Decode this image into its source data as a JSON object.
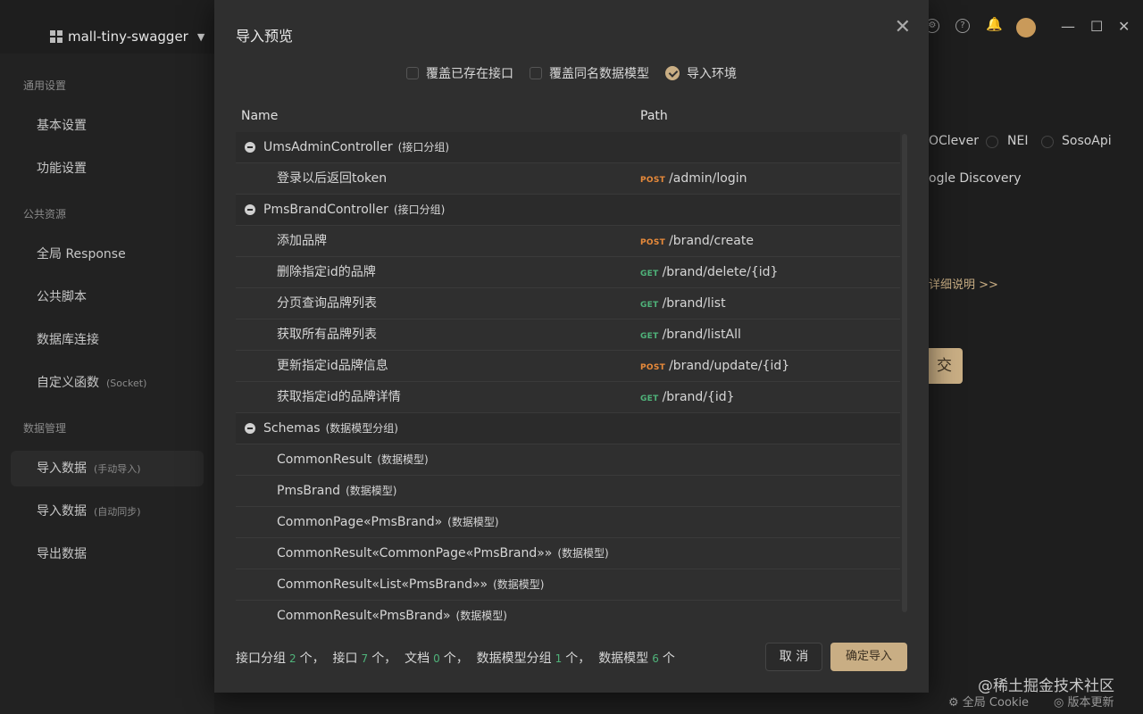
{
  "app": {
    "project_name": "mall-tiny-swagger"
  },
  "sidebar": {
    "sections": [
      {
        "title": "通用设置"
      },
      {
        "title": "公共资源"
      },
      {
        "title": "数据管理"
      }
    ],
    "items": [
      {
        "label": "基本设置",
        "sub": ""
      },
      {
        "label": "功能设置",
        "sub": ""
      },
      {
        "label": "全局 Response",
        "sub": ""
      },
      {
        "label": "公共脚本",
        "sub": ""
      },
      {
        "label": "数据库连接",
        "sub": ""
      },
      {
        "label": "自定义函数",
        "sub": "(Socket)"
      },
      {
        "label": "导入数据",
        "sub": "(手动导入)"
      },
      {
        "label": "导入数据",
        "sub": "(自动同步)"
      },
      {
        "label": "导出数据",
        "sub": ""
      }
    ]
  },
  "background": {
    "option_a": "OClever",
    "option_b": "NEI",
    "option_c": "SosoApi",
    "option_d": "ogle Discovery",
    "detail_link": "详细说明 >>",
    "submit_partial": "交",
    "footer_cookie": "全局 Cookie",
    "footer_update": "版本更新",
    "watermark": "@稀土掘金技术社区"
  },
  "modal": {
    "title": "导入预览",
    "options": [
      {
        "label": "覆盖已存在接口",
        "checked": false
      },
      {
        "label": "覆盖同名数据模型",
        "checked": false
      },
      {
        "label": "导入环境",
        "checked": true
      }
    ],
    "columns": {
      "name": "Name",
      "path": "Path"
    },
    "rows": [
      {
        "type": "group",
        "name": "UmsAdminController",
        "tag": "(接口分组)"
      },
      {
        "type": "api",
        "name": "登录以后返回token",
        "method": "POST",
        "path": "/admin/login"
      },
      {
        "type": "group",
        "name": "PmsBrandController",
        "tag": "(接口分组)"
      },
      {
        "type": "api",
        "name": "添加品牌",
        "method": "POST",
        "path": "/brand/create"
      },
      {
        "type": "api",
        "name": "删除指定id的品牌",
        "method": "GET",
        "path": "/brand/delete/{id}"
      },
      {
        "type": "api",
        "name": "分页查询品牌列表",
        "method": "GET",
        "path": "/brand/list"
      },
      {
        "type": "api",
        "name": "获取所有品牌列表",
        "method": "GET",
        "path": "/brand/listAll"
      },
      {
        "type": "api",
        "name": "更新指定id品牌信息",
        "method": "POST",
        "path": "/brand/update/{id}"
      },
      {
        "type": "api",
        "name": "获取指定id的品牌详情",
        "method": "GET",
        "path": "/brand/{id}"
      },
      {
        "type": "group",
        "name": "Schemas",
        "tag": "(数据模型分组)"
      },
      {
        "type": "model",
        "name": "CommonResult",
        "tag": "(数据模型)"
      },
      {
        "type": "model",
        "name": "PmsBrand",
        "tag": "(数据模型)"
      },
      {
        "type": "model",
        "name": "CommonPage«PmsBrand»",
        "tag": "(数据模型)"
      },
      {
        "type": "model",
        "name": "CommonResult«CommonPage«PmsBrand»»",
        "tag": "(数据模型)"
      },
      {
        "type": "model",
        "name": "CommonResult«List«PmsBrand»»",
        "tag": "(数据模型)"
      },
      {
        "type": "model",
        "name": "CommonResult«PmsBrand»",
        "tag": "(数据模型)"
      }
    ],
    "summary": {
      "group_label": "接口分组",
      "group_count": "2",
      "group_unit": "个，",
      "api_label": "接口",
      "api_count": "7",
      "api_unit": "个，",
      "doc_label": "文档",
      "doc_count": "0",
      "doc_unit": "个，",
      "model_group_label": "数据模型分组",
      "model_group_count": "1",
      "model_group_unit": "个，",
      "model_label": "数据模型",
      "model_count": "6",
      "model_unit": "个"
    },
    "cancel_label": "取 消",
    "confirm_label": "确定导入"
  },
  "colors": {
    "accent": "#c9ae84",
    "post": "#e88a3a",
    "get": "#4fb37a"
  }
}
